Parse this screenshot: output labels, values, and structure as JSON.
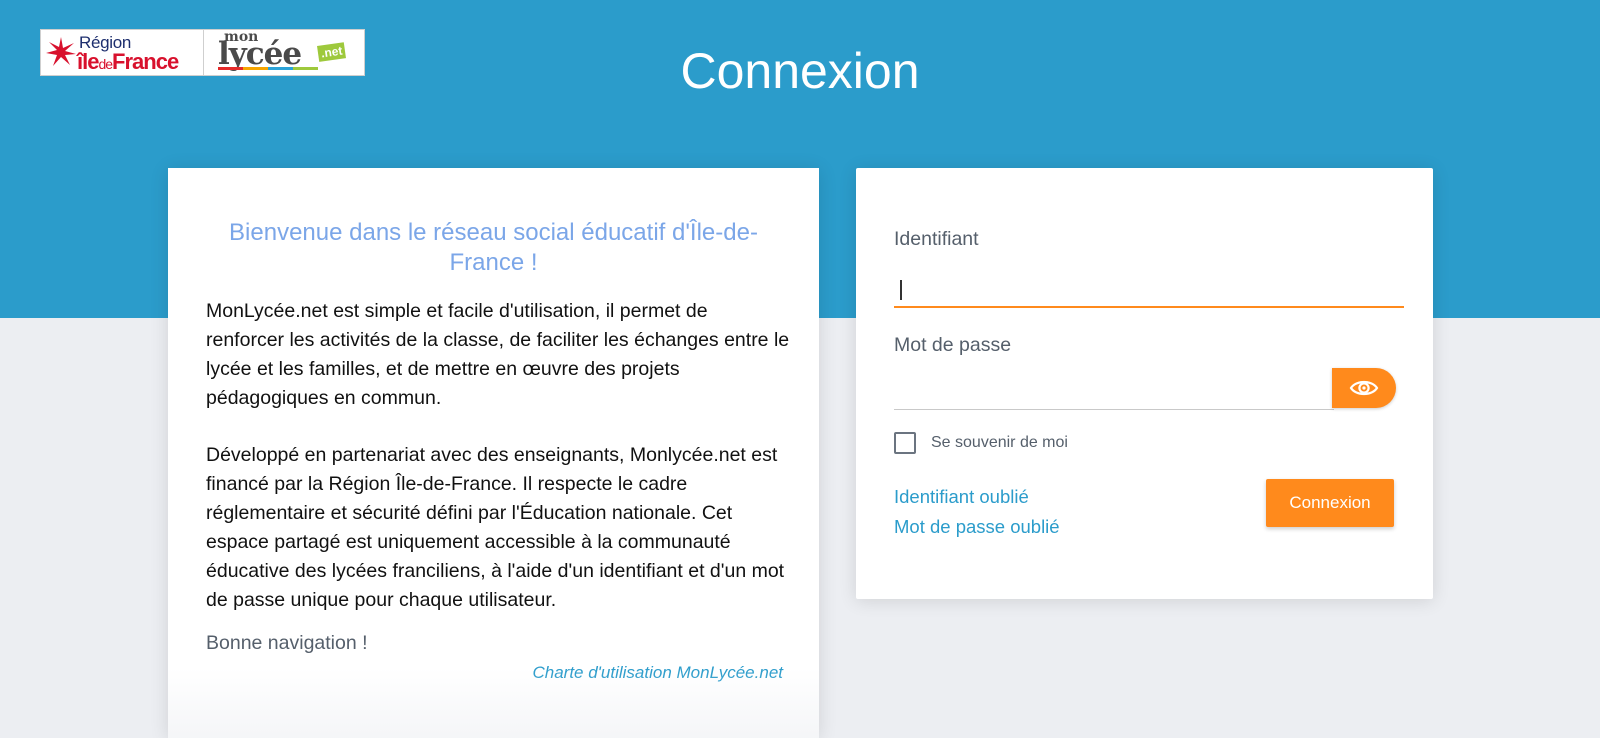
{
  "header": {
    "title": "Connexion",
    "logo": {
      "region_top": "Région",
      "region_bottom_a": "île",
      "region_bottom_b": "de",
      "region_bottom_c": "France",
      "mon": "mon",
      "lycee": "lycée",
      "net": ".net"
    }
  },
  "welcome": {
    "title": "Bienvenue dans le réseau social éducatif d'Île-de-France !",
    "paragraph1": "MonLycée.net est simple et facile d'utilisation, il permet de renforcer les activités de la classe, de faciliter les échanges entre le lycée et les familles, et de mettre en œuvre des projets pédagogiques en commun.",
    "paragraph2": "Développé en partenariat avec des enseignants, Monlycée.net est financé par la Région Île-de-France. Il respecte le cadre réglementaire et sécurité défini par l'Éducation nationale. Cet espace partagé est uniquement accessible à la communauté éducative des lycées franciliens, à l'aide d'un identifiant et d'un mot de passe unique pour chaque utilisateur.",
    "closing": "Bonne navigation !",
    "charter_link": "Charte d'utilisation MonLycée.net"
  },
  "login": {
    "username_label": "Identifiant",
    "username_value": "",
    "password_label": "Mot de passe",
    "password_value": "",
    "show_password_icon": "eye-icon",
    "remember_label": "Se souvenir de moi",
    "remember_checked": false,
    "forgot_username": "Identifiant oublié",
    "forgot_password": "Mot de passe oublié",
    "submit_label": "Connexion"
  },
  "colors": {
    "header_blue": "#2b9ccb",
    "accent_orange": "#ff8a1c",
    "welcome_title": "#7ba6e8",
    "link_blue": "#2b9ccb",
    "background": "#eceef2"
  }
}
